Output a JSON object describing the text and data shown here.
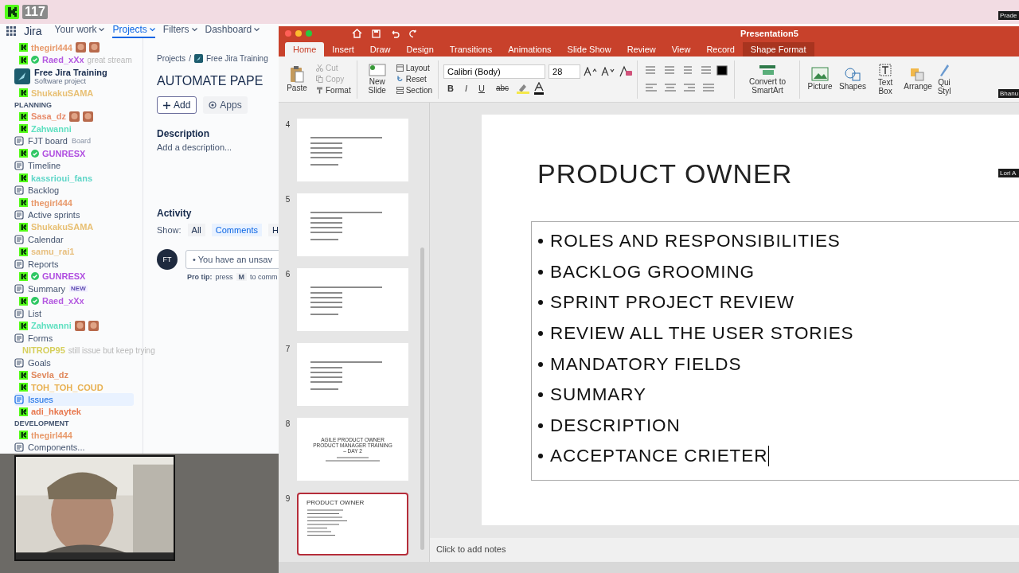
{
  "stream": {
    "viewer_count": "117"
  },
  "participants": [
    {
      "name": "Prade"
    },
    {
      "name": "Bhanu"
    },
    {
      "name": "Lori A"
    }
  ],
  "jira": {
    "logo": "Jira",
    "nav": [
      {
        "label": "Your work",
        "selected": false
      },
      {
        "label": "Projects",
        "selected": true
      },
      {
        "label": "Filters",
        "selected": false
      },
      {
        "label": "Dashboard",
        "selected": false
      }
    ],
    "left_rows": [
      {
        "kind": "chat",
        "user": "thegirl444",
        "color": "#e89a6c",
        "verified": false,
        "emotes": [
          {
            "kind": "emote"
          },
          {
            "kind": "emote"
          }
        ]
      },
      {
        "kind": "chat",
        "user": "Raed_xXx",
        "color": "#b45ae0",
        "verified": true,
        "message": "great stream"
      },
      {
        "kind": "project",
        "label": "Free Jira Training",
        "sub": "Software project"
      },
      {
        "kind": "chat",
        "user": "ShukakuSAMA",
        "color": "#e8c074",
        "verified": false
      },
      {
        "kind": "section",
        "label": "PLANNING"
      },
      {
        "kind": "chat",
        "user": "Sasa_dz",
        "color": "#e88c6c",
        "verified": false,
        "emotes": [
          {
            "kind": "emote"
          },
          {
            "kind": "emote"
          }
        ]
      },
      {
        "kind": "chat",
        "user": "Zahwanni",
        "color": "#5fe0c0",
        "verified": false
      },
      {
        "kind": "nav",
        "label": "FJT board",
        "sub": "Board",
        "selected": false
      },
      {
        "kind": "chat",
        "user": "GUNRESX",
        "color": "#b04ee0",
        "verified": true
      },
      {
        "kind": "nav",
        "label": "Timeline",
        "selected": false
      },
      {
        "kind": "chat",
        "user": "kassrioui_fans",
        "color": "#5fd6c8",
        "verified": false
      },
      {
        "kind": "nav",
        "label": "Backlog",
        "selected": false
      },
      {
        "kind": "chat",
        "user": "thegirl444",
        "color": "#e89a6c",
        "verified": false
      },
      {
        "kind": "nav",
        "label": "Active sprints",
        "selected": false
      },
      {
        "kind": "chat",
        "user": "ShukakuSAMA",
        "color": "#e8c074",
        "verified": false
      },
      {
        "kind": "nav",
        "label": "Calendar",
        "selected": false
      },
      {
        "kind": "chat",
        "user": "samu_rai1",
        "color": "#e8c080",
        "verified": false
      },
      {
        "kind": "nav",
        "label": "Reports",
        "selected": false
      },
      {
        "kind": "chat",
        "user": "GUNRESX",
        "color": "#b04ee0",
        "verified": true
      },
      {
        "kind": "nav",
        "label": "Summary",
        "badge": "NEW",
        "selected": false
      },
      {
        "kind": "chat",
        "user": "Raed_xXx",
        "color": "#b45ae0",
        "verified": true
      },
      {
        "kind": "nav",
        "label": "List",
        "selected": false
      },
      {
        "kind": "chat",
        "user": "Zahwanni",
        "color": "#5fe0c0",
        "verified": false,
        "emotes": [
          {
            "kind": "emote"
          },
          {
            "kind": "emote"
          }
        ]
      },
      {
        "kind": "nav",
        "label": "Forms",
        "selected": false
      },
      {
        "kind": "chat",
        "user": "NITROP95",
        "color": "#d6cf5c",
        "verified": false,
        "message": "still issue but keep trying"
      },
      {
        "kind": "nav",
        "label": "Goals",
        "selected": false
      },
      {
        "kind": "chat",
        "user": "Sevla_dz",
        "color": "#e0885c",
        "verified": false
      },
      {
        "kind": "chat",
        "user": "TOH_TOH_COUD",
        "color": "#e8b050",
        "verified": false
      },
      {
        "kind": "nav",
        "label": "Issues",
        "selected": true
      },
      {
        "kind": "chat",
        "user": "adi_hkaytek",
        "color": "#e8784e",
        "verified": false
      },
      {
        "kind": "section",
        "label": "DEVELOPMENT"
      },
      {
        "kind": "chat",
        "user": "thegirl444",
        "color": "#e89a6c",
        "verified": false
      },
      {
        "kind": "nav",
        "label": "Components...",
        "selected": false
      }
    ],
    "breadcrumb": [
      "Projects",
      "Free Jira Training"
    ],
    "breadcrumb_separator": "/",
    "issue_title": "AUTOMATE PAPE",
    "add_button": "Add",
    "apps_button": "Apps",
    "description_heading": "Description",
    "description_placeholder": "Add a description...",
    "activity_heading": "Activity",
    "show_label": "Show:",
    "activity_filters": [
      {
        "label": "All",
        "selected": false
      },
      {
        "label": "Comments",
        "selected": true
      },
      {
        "label": "H",
        "selected": false
      }
    ],
    "avatar": "FT",
    "comment_value": "• You have an unsav",
    "pro_tip": {
      "label": "Pro tip:",
      "text1": "press",
      "key": "M",
      "text2": "to comm"
    }
  },
  "powerpoint": {
    "title": "Presentation5",
    "tabs": [
      {
        "label": "Home",
        "selected": true,
        "contextual": false
      },
      {
        "label": "Insert",
        "selected": false,
        "contextual": false
      },
      {
        "label": "Draw",
        "selected": false,
        "contextual": false
      },
      {
        "label": "Design",
        "selected": false,
        "contextual": false
      },
      {
        "label": "Transitions",
        "selected": false,
        "contextual": false
      },
      {
        "label": "Animations",
        "selected": false,
        "contextual": false
      },
      {
        "label": "Slide Show",
        "selected": false,
        "contextual": false
      },
      {
        "label": "Review",
        "selected": false,
        "contextual": false
      },
      {
        "label": "View",
        "selected": false,
        "contextual": false
      },
      {
        "label": "Record",
        "selected": false,
        "contextual": false
      },
      {
        "label": "Shape Format",
        "selected": false,
        "contextual": true
      }
    ],
    "ribbon": {
      "paste": "Paste",
      "cut": "Cut",
      "copy": "Copy",
      "format": "Format",
      "new_slide": "New Slide",
      "layout": "Layout",
      "reset": "Reset",
      "section": "Section",
      "font": "Calibri (Body)",
      "size": "28",
      "format_buttons": [
        "B",
        "I",
        "U",
        "abc"
      ],
      "smartart": "Convert to SmartArt",
      "picture": "Picture",
      "shapes": "Shapes",
      "text_box": "Text Box",
      "arrange": "Arrange",
      "quick_styles": "Qui Styl"
    },
    "thumbnails": [
      {
        "number": "4",
        "kind": "lines",
        "selected": false
      },
      {
        "number": "5",
        "kind": "lines",
        "selected": false
      },
      {
        "number": "6",
        "kind": "lines",
        "selected": false
      },
      {
        "number": "7",
        "kind": "lines",
        "selected": false
      },
      {
        "number": "8",
        "kind": "title",
        "title": "AGILE PRODUCT OWNER PRODUCT MANAGER TRAINING – DAY 2",
        "selected": false
      },
      {
        "number": "9",
        "kind": "heading",
        "title": "PRODUCT OWNER",
        "selected": true
      }
    ],
    "slide": {
      "title": "PRODUCT OWNER",
      "bullets": [
        "ROLES AND RESPONSIBILITIES",
        "BACKLOG GROOMING",
        "SPRINT PROJECT REVIEW",
        "REVIEW ALL THE USER STORIES",
        "MANDATORY FIELDS",
        "SUMMARY",
        "DESCRIPTION",
        "ACCEPTANCE CRIETER"
      ]
    },
    "notes_placeholder": "Click to add notes"
  }
}
